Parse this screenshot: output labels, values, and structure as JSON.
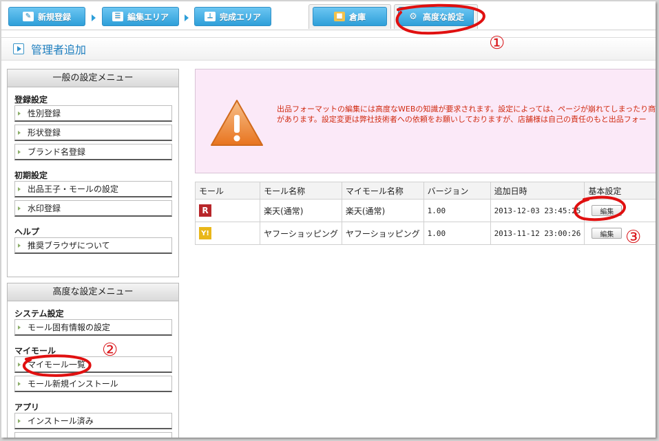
{
  "tabs": [
    {
      "label": "新規登録",
      "icon": "edit-icon"
    },
    {
      "label": "編集エリア",
      "icon": "list-icon"
    },
    {
      "label": "完成エリア",
      "icon": "tree-icon"
    },
    {
      "label": "倉庫",
      "icon": "box-icon"
    },
    {
      "label": "高度な設定",
      "icon": "gear-icon"
    }
  ],
  "page": {
    "title": "管理者追加"
  },
  "general_menu": {
    "title": "一般の設定メニュー",
    "sections": [
      {
        "title": "登録設定",
        "items": [
          "性別登録",
          "形状登録",
          "ブランド名登録"
        ]
      },
      {
        "title": "初期設定",
        "items": [
          "出品王子・モールの設定",
          "水印登録"
        ]
      },
      {
        "title": "ヘルプ",
        "items": [
          "推奨ブラウザについて"
        ]
      }
    ]
  },
  "advanced_menu": {
    "title": "高度な設定メニュー",
    "sections": [
      {
        "title": "システム設定",
        "items": [
          "モール固有情報の設定"
        ]
      },
      {
        "title": "マイモール",
        "items": [
          "マイモール一覧",
          "モール新規インストール"
        ]
      },
      {
        "title": "アプリ",
        "items": [
          "インストール済み"
        ]
      }
    ]
  },
  "warning": {
    "line1": "出品フォーマットの編集には高度なWEBの知識が要求されます。設定によっては、ページが崩れてしまったり商",
    "line2": "があります。設定変更は弊社技術者への依頼をお願いしておりますが、店舗様は自己の責任のもと出品フォー"
  },
  "table": {
    "headers": [
      "モール",
      "モール名称",
      "マイモール名称",
      "バージョン",
      "追加日時",
      "基本設定"
    ],
    "rows": [
      {
        "logo": "R",
        "mall_name": "楽天(通常)",
        "my_mall_name": "楽天(通常)",
        "version": "1.00",
        "added": "2013-12-03 23:45:25",
        "action": "編集"
      },
      {
        "logo": "Y!",
        "mall_name": "ヤフーショッピング",
        "my_mall_name": "ヤフーショッピング",
        "version": "1.00",
        "added": "2013-11-12 23:00:26",
        "action": "編集"
      }
    ]
  },
  "annotations": {
    "n1": "①",
    "n2": "②",
    "n3": "③"
  },
  "colors": {
    "tab_blue": "#2e9fd9",
    "title_blue": "#1f7fbf",
    "warning_red": "#d02a10",
    "annotation_red": "#d9161a",
    "warning_bg": "#fbe9f8"
  }
}
